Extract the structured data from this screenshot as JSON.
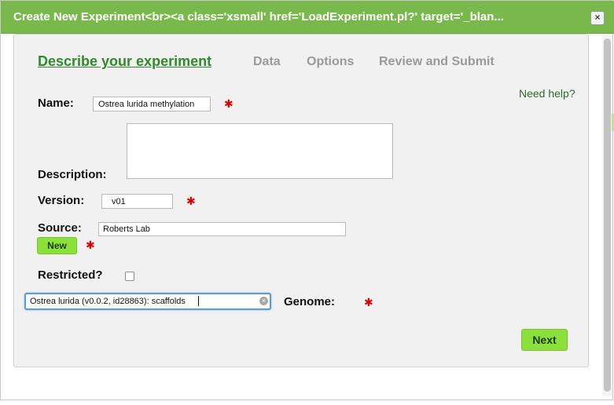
{
  "dialog": {
    "title": "Create New Experiment<br><a class='xsmall' href='LoadExperiment.pl?' target='_blan...",
    "close_label": "×"
  },
  "tabs": [
    {
      "label": "Describe your experiment",
      "active": true
    },
    {
      "label": "Data",
      "active": false
    },
    {
      "label": "Options",
      "active": false
    },
    {
      "label": "Review and Submit",
      "active": false
    }
  ],
  "help_link": "Need help?",
  "form": {
    "name": {
      "label": "Name:",
      "value": "Ostrea lurida methylation"
    },
    "description": {
      "label": "Description:",
      "value": ""
    },
    "version": {
      "label": "Version:",
      "value": "v01"
    },
    "source": {
      "label": "Source:",
      "value": "Roberts Lab",
      "new_button": "New"
    },
    "restricted": {
      "label": "Restricted?",
      "checked": false
    },
    "genome": {
      "label": "Genome:",
      "value": "Ostrea lurida (v0.0.2, id28863): scaffolds"
    },
    "required_mark": "✱"
  },
  "actions": {
    "next": "Next"
  },
  "colors": {
    "titlebar": "#79b94b",
    "active_tab": "#2f8a2a",
    "button_green": "#8be03a",
    "required": "#e00000"
  }
}
